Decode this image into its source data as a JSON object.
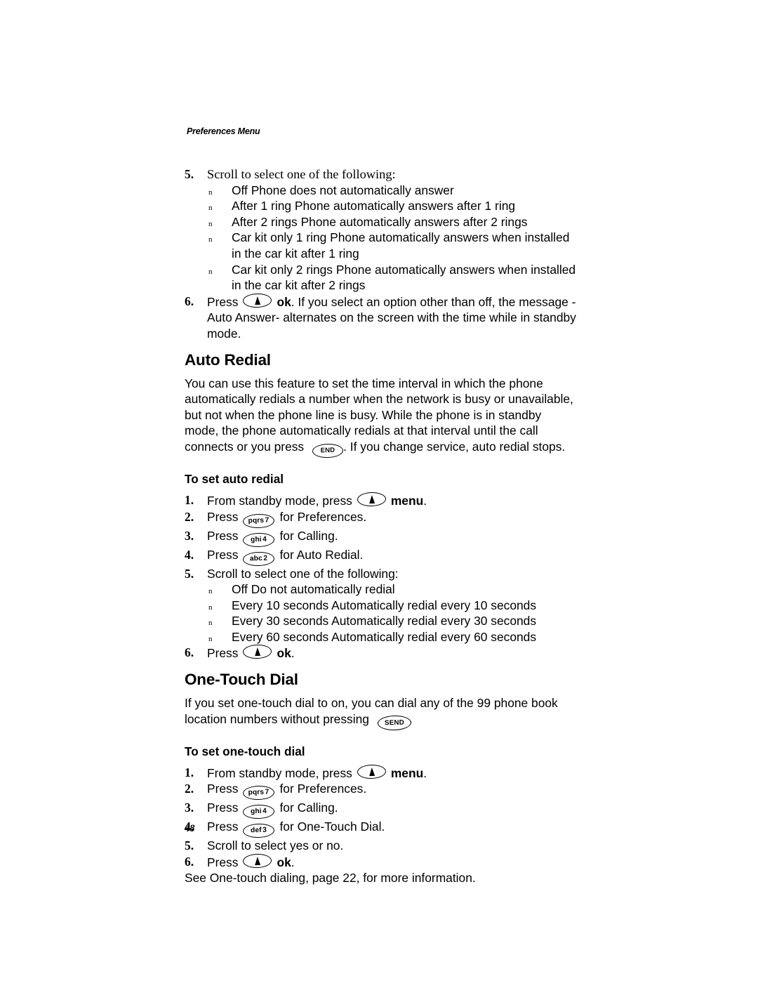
{
  "document": {
    "running_header": "Preferences Menu",
    "page_number": "48"
  },
  "auto_answer_continued": {
    "step5": {
      "number": "5.",
      "text": "Scroll to select one of the following:"
    },
    "options": [
      {
        "marker": "n",
        "text": "Off  Phone does not automatically answer"
      },
      {
        "marker": "n",
        "text": "After 1 ring  Phone automatically answers after 1 ring"
      },
      {
        "marker": "n",
        "text": "After 2 rings  Phone automatically answers after 2 rings"
      },
      {
        "marker": "n",
        "text": "Car kit only 1 ring  Phone automatically answers when installed in the car kit after 1 ring"
      },
      {
        "marker": "n",
        "text": "Car kit only 2 rings  Phone automatically answers when installed in the car kit after 2 rings"
      }
    ],
    "step6": {
      "number": "6.",
      "lead": "Press",
      "key": "nav-up-key",
      "bold_label": "ok",
      "tail": ". If you select an option other than  off,  the message -Auto Answer-  alternates on the screen with the time while in standby mode."
    }
  },
  "auto_redial": {
    "heading": "Auto Redial",
    "intro_part1": "You can use this feature to set the time interval in which the phone automatically redials a number when the network is busy or unavailable, but not when the phone line is busy. While the phone is in standby mode, the phone automatically redials at that interval until the call connects or you press",
    "intro_key": "END",
    "intro_part2": ". If you change service, auto redial stops.",
    "subheading": "To set auto redial",
    "steps": [
      {
        "number": "1.",
        "pre": "From standby mode, press",
        "key_type": "nav",
        "key_letters": "",
        "key_digit": "",
        "bold": "menu",
        "post": "."
      },
      {
        "number": "2.",
        "pre": "Press",
        "key_type": "pad",
        "key_letters": "pqrs",
        "key_digit": "7",
        "bold": "",
        "post": "for Preferences."
      },
      {
        "number": "3.",
        "pre": "Press",
        "key_type": "pad",
        "key_letters": "ghi",
        "key_digit": "4",
        "bold": "",
        "post": "for Calling."
      },
      {
        "number": "4.",
        "pre": "Press",
        "key_type": "pad",
        "key_letters": "abc",
        "key_digit": "2",
        "bold": "",
        "post": "for Auto Redial."
      },
      {
        "number": "5.",
        "pre": "Scroll to select one of the following:",
        "key_type": "none",
        "key_letters": "",
        "key_digit": "",
        "bold": "",
        "post": ""
      }
    ],
    "options": [
      {
        "marker": "n",
        "text": "Off  Do not automatically redial"
      },
      {
        "marker": "n",
        "text": "Every 10 seconds  Automatically redial every 10 seconds"
      },
      {
        "marker": "n",
        "text": "Every 30 seconds  Automatically redial every 30 seconds"
      },
      {
        "marker": "n",
        "text": "Every 60 seconds  Automatically redial every 60 seconds"
      }
    ],
    "final_step": {
      "number": "6.",
      "pre": "Press",
      "bold": "ok",
      "post": "."
    }
  },
  "one_touch_dial": {
    "heading": "One-Touch Dial",
    "intro_part1": "If you set one-touch dial to  on,  you can dial any of the 99 phone book location numbers without pressing",
    "intro_key": "SEND",
    "subheading": "To set one-touch dial",
    "steps": [
      {
        "number": "1.",
        "pre": "From standby mode, press",
        "key_type": "nav",
        "key_letters": "",
        "key_digit": "",
        "bold": "menu",
        "post": "."
      },
      {
        "number": "2.",
        "pre": "Press",
        "key_type": "pad",
        "key_letters": "pqrs",
        "key_digit": "7",
        "bold": "",
        "post": "for Preferences."
      },
      {
        "number": "3.",
        "pre": "Press",
        "key_type": "pad",
        "key_letters": "ghi",
        "key_digit": "4",
        "bold": "",
        "post": "for Calling."
      },
      {
        "number": "4.",
        "pre": "Press",
        "key_type": "pad",
        "key_letters": "def",
        "key_digit": "3",
        "bold": "",
        "post": "for One-Touch Dial."
      },
      {
        "number": "5.",
        "pre": "Scroll to select  yes  or  no.",
        "key_type": "none",
        "key_letters": "",
        "key_digit": "",
        "bold": "",
        "post": ""
      }
    ],
    "final_step": {
      "number": "6.",
      "pre": "Press",
      "bold": "ok",
      "post": "."
    },
    "cross_reference": "See One-touch dialing, page 22, for more information."
  }
}
